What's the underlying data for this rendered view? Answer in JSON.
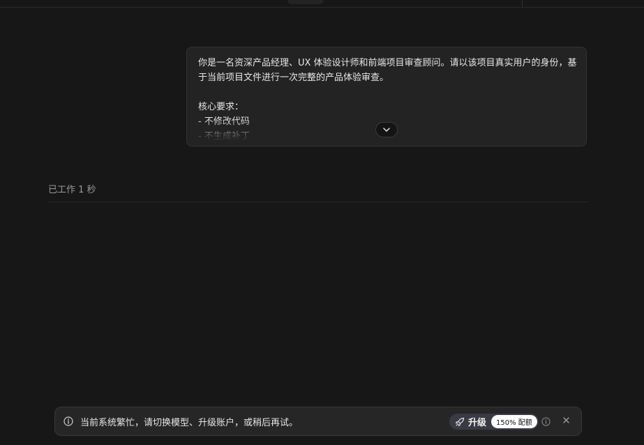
{
  "message": {
    "text": "你是一名资深产品经理、UX 体验设计师和前端项目审查顾问。请以该项目真实用户的身份，基于当前项目文件进行一次完整的产品体验审查。\n\n核心要求：\n- 不修改代码\n- 不生成补丁",
    "expand_icon": "chevron-down-icon"
  },
  "status": {
    "worked": "已工作 1 秒"
  },
  "notice": {
    "text": "当前系统繁忙，请切换模型、升级账户，或稍后再试。",
    "upgrade_label": "升级",
    "quota_badge": "150% 配额",
    "info_icon": "info-icon",
    "upgrade_icon": "rocket-icon",
    "close_icon": "close-icon"
  }
}
